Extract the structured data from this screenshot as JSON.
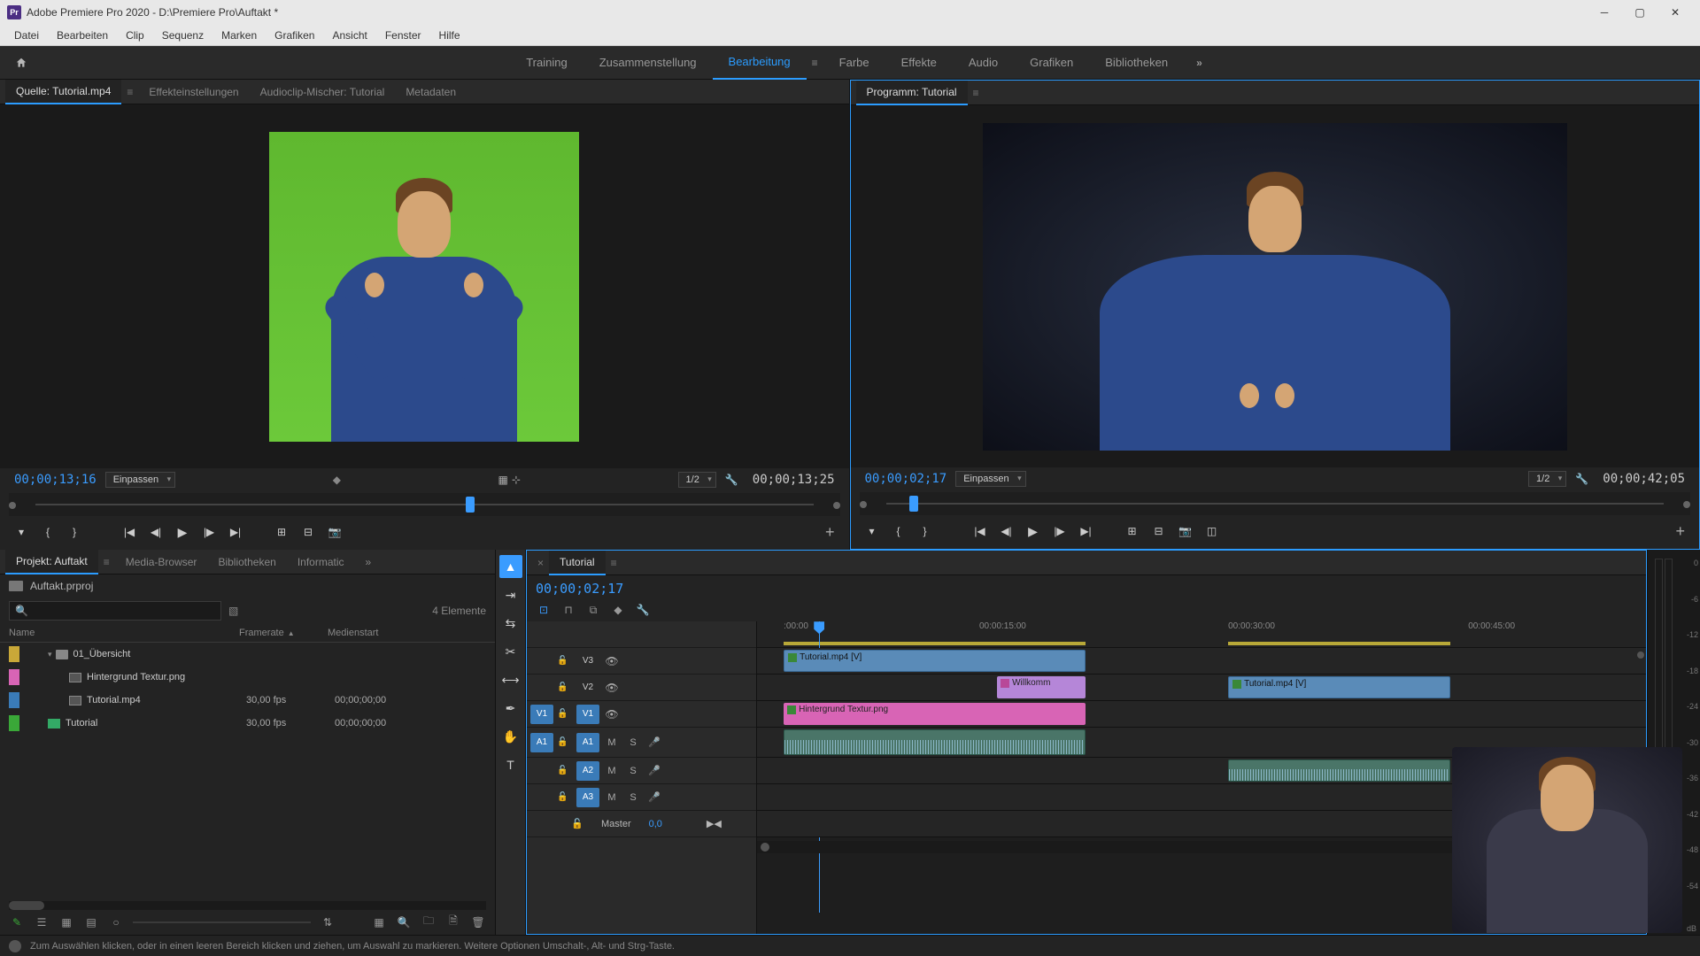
{
  "titlebar": {
    "text": "Adobe Premiere Pro 2020 - D:\\Premiere Pro\\Auftakt *"
  },
  "menubar": [
    "Datei",
    "Bearbeiten",
    "Clip",
    "Sequenz",
    "Marken",
    "Grafiken",
    "Ansicht",
    "Fenster",
    "Hilfe"
  ],
  "workspaces": [
    "Training",
    "Zusammenstellung",
    "Bearbeitung",
    "Farbe",
    "Effekte",
    "Audio",
    "Grafiken",
    "Bibliotheken"
  ],
  "workspace_active": "Bearbeitung",
  "source": {
    "tabs": [
      "Quelle: Tutorial.mp4",
      "Effekteinstellungen",
      "Audioclip-Mischer: Tutorial",
      "Metadaten"
    ],
    "tc_in": "00;00;13;16",
    "tc_dur": "00;00;13;25",
    "fit": "Einpassen",
    "zoom": "1/2"
  },
  "program": {
    "tab": "Programm: Tutorial",
    "tc_in": "00;00;02;17",
    "tc_dur": "00;00;42;05",
    "fit": "Einpassen",
    "zoom": "1/2"
  },
  "project": {
    "tabs": [
      "Projekt: Auftakt",
      "Media-Browser",
      "Bibliotheken",
      "Informatic"
    ],
    "file": "Auftakt.prproj",
    "count": "4 Elemente",
    "cols": {
      "name": "Name",
      "framerate": "Framerate",
      "medienstart": "Medienstart"
    },
    "rows": [
      {
        "swatch": "yellow",
        "type": "bin",
        "name": "01_Übersicht",
        "fr": "",
        "ms": ""
      },
      {
        "swatch": "pink",
        "type": "img",
        "name": "Hintergrund Textur.png",
        "fr": "",
        "ms": ""
      },
      {
        "swatch": "blue",
        "type": "vid",
        "name": "Tutorial.mp4",
        "fr": "30,00 fps",
        "ms": "00;00;00;00"
      },
      {
        "swatch": "green",
        "type": "seq",
        "name": "Tutorial",
        "fr": "30,00 fps",
        "ms": "00;00;00;00"
      }
    ]
  },
  "timeline": {
    "tab": "Tutorial",
    "tc": "00;00;02;17",
    "ticks": [
      {
        "label": ":00:00",
        "pos": 3
      },
      {
        "label": "00:00:15:00",
        "pos": 25
      },
      {
        "label": "00:00:30:00",
        "pos": 53
      },
      {
        "label": "00:00:45:00",
        "pos": 80
      }
    ],
    "tracks": {
      "v3": "V3",
      "v2": "V2",
      "v1": "V1",
      "a1": "A1",
      "a2": "A2",
      "a3": "A3",
      "master": "Master",
      "master_val": "0,0"
    },
    "src": {
      "v1": "V1",
      "a1": "A1"
    },
    "tog": {
      "m": "M",
      "s": "S"
    },
    "clips": {
      "v3": {
        "label": "Tutorial.mp4 [V]"
      },
      "v2a": {
        "label": "Willkomm"
      },
      "v2b": {
        "label": "Tutorial.mp4 [V]"
      },
      "v1": {
        "label": "Hintergrund Textur.png"
      }
    }
  },
  "meter": {
    "scale": [
      "0",
      "-6",
      "-12",
      "-18",
      "-24",
      "-30",
      "-36",
      "-42",
      "-48",
      "-54",
      ""
    ],
    "unit": "dB"
  },
  "status": "Zum Auswählen klicken, oder in einen leeren Bereich klicken und ziehen, um Auswahl zu markieren. Weitere Optionen Umschalt-, Alt- und Strg-Taste."
}
